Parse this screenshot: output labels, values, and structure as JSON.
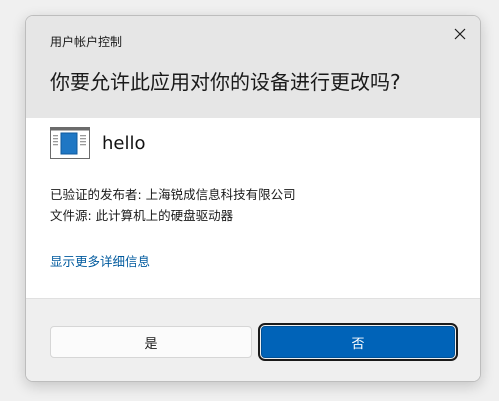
{
  "window_title": "用户帐户控制",
  "question": "你要允许此应用对你的设备进行更改吗?",
  "app": {
    "name": "hello",
    "icon": "application-window-icon"
  },
  "details": {
    "publisher": "已验证的发布者: 上海锐成信息科技有限公司",
    "origin": "文件源: 此计算机上的硬盘驱动器"
  },
  "more_details_link": "显示更多详细信息",
  "buttons": {
    "yes": "是",
    "no": "否"
  },
  "colors": {
    "header_bg": "#e6e6e6",
    "link": "#005a9e",
    "primary_button": "#0063b8"
  }
}
